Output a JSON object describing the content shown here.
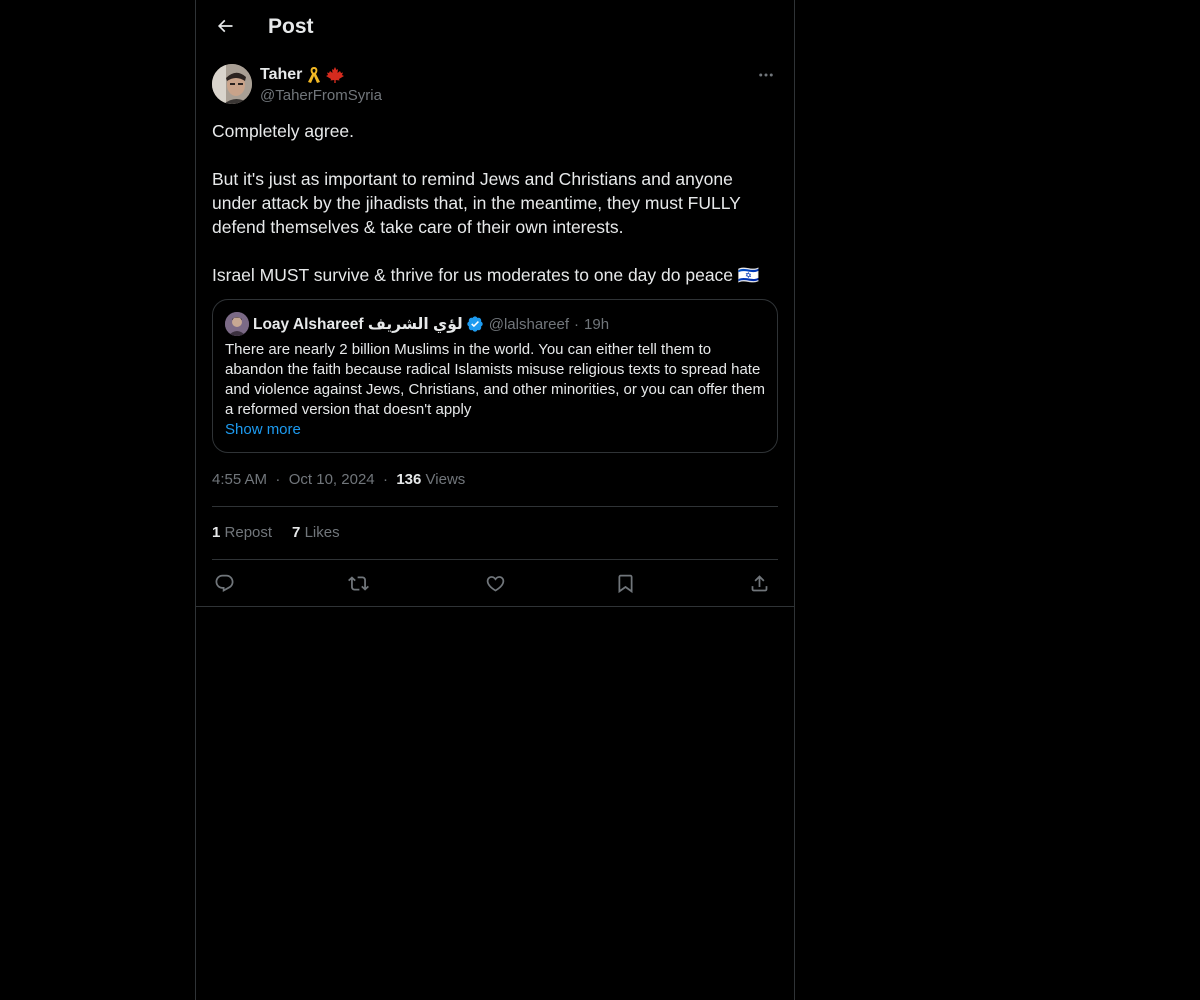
{
  "header": {
    "title": "Post",
    "back_icon": "arrow-left-icon"
  },
  "post": {
    "author": {
      "display_name": "Taher",
      "badges": [
        "yellow-ribbon-icon",
        "maple-leaf-icon"
      ],
      "handle": "@TaherFromSyria"
    },
    "more_icon": "more-horizontal-icon",
    "paragraphs": [
      "Completely agree.",
      "But it's just as important to remind Jews and Christians and anyone under attack by the jihadists that, in the meantime, they must FULLY defend themselves & take care of their own interests.",
      "Israel MUST survive & thrive for us moderates to one day do peace 🇮🇱"
    ],
    "quote": {
      "display_name": "Loay Alshareef لؤي الشريف",
      "verified": true,
      "handle": "@lalshareef",
      "separator": "·",
      "time": "19h",
      "text": "There are nearly 2 billion Muslims in the world. You can either tell them to abandon the faith because radical Islamists misuse religious texts to spread hate and violence against Jews, Christians, and other minorities, or you can offer them a reformed version that doesn't apply",
      "show_more": "Show more"
    },
    "meta": {
      "time": "4:55 AM",
      "separator": "·",
      "date": "Oct 10, 2024",
      "views_count": "136",
      "views_label": "Views"
    },
    "stats": {
      "reposts_count": "1",
      "reposts_label": "Repost",
      "likes_count": "7",
      "likes_label": "Likes"
    },
    "actions": [
      "reply-icon",
      "repost-icon",
      "like-icon",
      "bookmark-icon",
      "share-icon"
    ]
  },
  "colors": {
    "background": "#000000",
    "text": "#e7e9ea",
    "secondary_text": "#71767b",
    "border": "#2f3336",
    "link": "#1d9bf0",
    "verified": "#1d9bf0"
  }
}
